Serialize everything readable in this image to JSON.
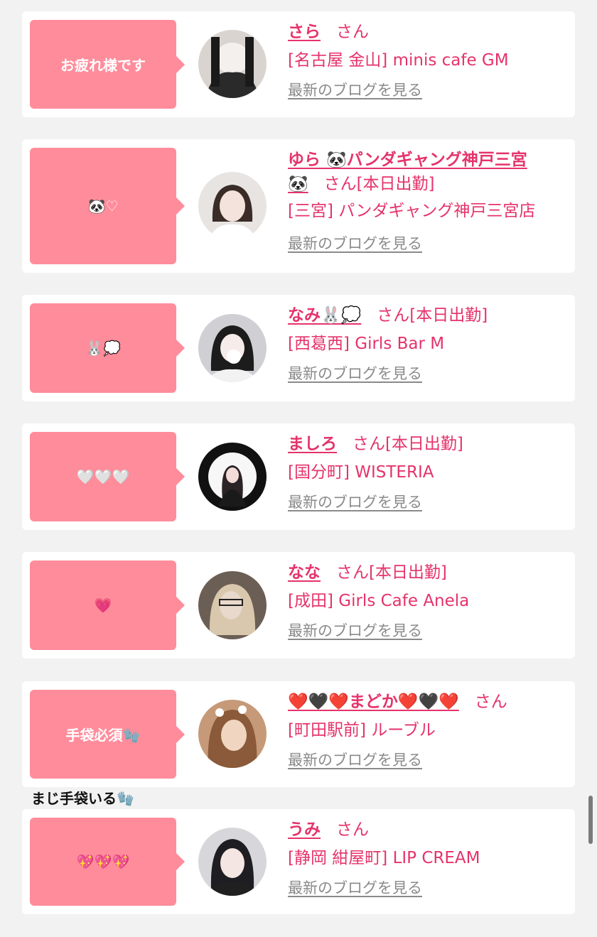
{
  "entries": [
    {
      "bubble": "お疲れ様です",
      "name": "さら",
      "san": "さん",
      "status": "",
      "shop": "[名古屋 金山] minis cafe GM",
      "blog": "最新のブログを見る"
    },
    {
      "bubble": "🐼♡",
      "name": "ゆら 🐼パンダギャング神戸三宮",
      "name2": "🐼",
      "san": "さん",
      "status": "[本日出勤]",
      "shop": "[三宮] パンダギャング神戸三宮店",
      "blog": "最新のブログを見る"
    },
    {
      "bubble": "🐰💭",
      "name": "なみ🐰💭",
      "san": "さん",
      "status": "[本日出勤]",
      "shop": "[西葛西] Girls Bar M",
      "blog": "最新のブログを見る"
    },
    {
      "bubble": "🤍🤍🤍",
      "name": "ましろ",
      "san": "さん",
      "status": "[本日出勤]",
      "shop": "[国分町] WISTERIA",
      "blog": "最新のブログを見る"
    },
    {
      "bubble": "💗",
      "name": "なな",
      "san": "さん",
      "status": "[本日出勤]",
      "shop": "[成田] Girls Cafe Anela",
      "blog": "最新のブログを見る"
    },
    {
      "bubble": "手袋必須🧤",
      "name": "❤️🖤❤️まどか❤️🖤❤️",
      "san": "さん",
      "status": "",
      "shop": "[町田駅前] ルーブル",
      "blog": "最新のブログを見る"
    },
    {
      "bubble": "💖💖💖",
      "name": "うみ",
      "san": "さん",
      "status": "",
      "shop": "[静岡 紺屋町] LIP CREAM",
      "blog": "最新のブログを見る"
    }
  ],
  "note": "まじ手袋いる🧤",
  "colors": {
    "accent": "#e5336b",
    "bubble": "#ff8c9b",
    "link_gray": "#8a8a8a"
  }
}
